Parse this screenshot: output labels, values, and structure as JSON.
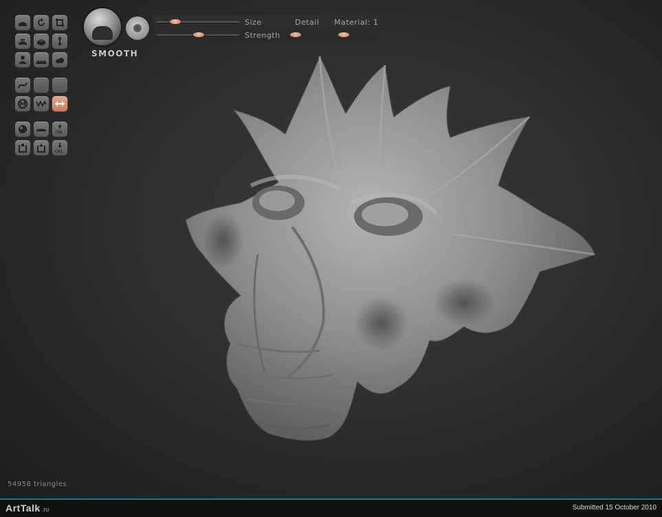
{
  "brush": {
    "name": "SMOOTH"
  },
  "sliders": {
    "size_label": "Size",
    "detail_label": "Detail",
    "material_label": "Material: 1",
    "strength_label": "Strength"
  },
  "status": {
    "triangles": "54958 triangles"
  },
  "footer": {
    "logo_text": "ArtTalk",
    "logo_domain": ".ru",
    "submitted": "Submitted 15 October 2010"
  },
  "colors": {
    "accent": "#c9855f",
    "active_tool": "#d99a7a",
    "viewport": "#303030",
    "mesh": "#8c8c8c",
    "footer_line": "#2a6aa8"
  },
  "tools": [
    {
      "name": "flatten-icon"
    },
    {
      "name": "rotate-icon"
    },
    {
      "name": "crop-icon"
    },
    {
      "name": "clay-icon"
    },
    {
      "name": "inflate-icon"
    },
    {
      "name": "move-icon"
    },
    {
      "name": "pinch-icon"
    },
    {
      "name": "bump-icon"
    },
    {
      "name": "cloud-icon"
    },
    {
      "name": "curve-icon"
    },
    {
      "name": "blank-icon"
    },
    {
      "name": "blank-icon"
    },
    {
      "name": "mask-icon"
    },
    {
      "name": "wave-icon"
    },
    {
      "name": "symmetry-icon"
    },
    {
      "name": "sphere-icon"
    },
    {
      "name": "plane-icon"
    },
    {
      "name": "export-obj-icon"
    },
    {
      "name": "save-icon"
    },
    {
      "name": "load-icon"
    },
    {
      "name": "import-obj-icon"
    }
  ]
}
